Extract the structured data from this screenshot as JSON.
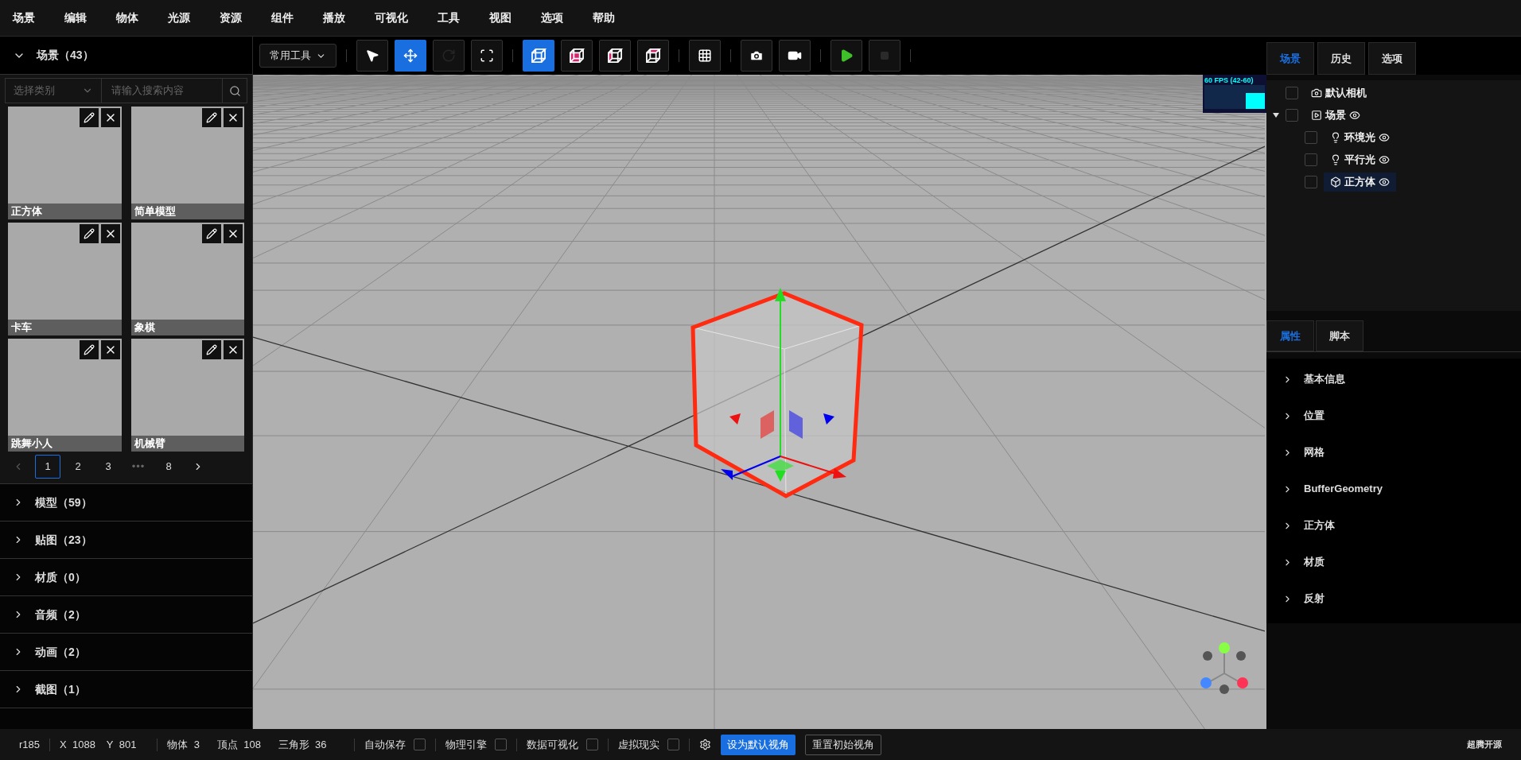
{
  "menu": [
    "场景",
    "编辑",
    "物体",
    "光源",
    "资源",
    "组件",
    "播放",
    "可视化",
    "工具",
    "视图",
    "选项",
    "帮助"
  ],
  "assets": {
    "title": "场景（43）",
    "expanded": true,
    "category_placeholder": "选择类别",
    "search_placeholder": "请输入搜索内容",
    "items": [
      {
        "label": "正方体"
      },
      {
        "label": "简单模型"
      },
      {
        "label": "卡车"
      },
      {
        "label": "象棋"
      },
      {
        "label": "跳舞小人"
      },
      {
        "label": "机械臂"
      }
    ],
    "pages": [
      {
        "label": "1",
        "kind": "page",
        "selected": true
      },
      {
        "label": "2",
        "kind": "page",
        "selected": false
      },
      {
        "label": "3",
        "kind": "page",
        "selected": false
      },
      {
        "label": "•••",
        "kind": "ellipsis",
        "selected": false
      },
      {
        "label": "8",
        "kind": "page",
        "selected": false
      }
    ],
    "sections": [
      {
        "title": "模型（59）",
        "expanded": false
      },
      {
        "title": "贴图（23）",
        "expanded": false
      },
      {
        "title": "材质（0）",
        "expanded": false
      },
      {
        "title": "音频（2）",
        "expanded": false
      },
      {
        "title": "动画（2）",
        "expanded": false
      },
      {
        "title": "截图（1）",
        "expanded": false
      }
    ]
  },
  "toolbar": {
    "dropdown": "常用工具",
    "groups": [
      [
        {
          "kind": "select",
          "selected": false,
          "disabled": false
        },
        {
          "kind": "move",
          "selected": true,
          "disabled": false
        },
        {
          "kind": "rotate",
          "selected": false,
          "disabled": true
        },
        {
          "kind": "scale",
          "selected": false,
          "disabled": false
        }
      ],
      [
        {
          "kind": "view-wire",
          "selected": true,
          "disabled": false
        },
        {
          "kind": "view-front",
          "selected": false,
          "disabled": false
        },
        {
          "kind": "view-side",
          "selected": false,
          "disabled": false
        },
        {
          "kind": "view-top",
          "selected": false,
          "disabled": false
        }
      ],
      [
        {
          "kind": "grid",
          "selected": false,
          "disabled": false
        }
      ],
      [
        {
          "kind": "camera",
          "selected": false,
          "disabled": false
        },
        {
          "kind": "video",
          "selected": false,
          "disabled": false
        }
      ],
      [
        {
          "kind": "play",
          "selected": false,
          "disabled": false
        },
        {
          "kind": "stop",
          "selected": false,
          "disabled": true
        }
      ]
    ]
  },
  "viewport": {
    "fps": "60 FPS (42-60)"
  },
  "outliner": {
    "tabs": [
      {
        "label": "场景",
        "selected": true
      },
      {
        "label": "历史",
        "selected": false
      },
      {
        "label": "选项",
        "selected": false
      }
    ],
    "tree": [
      {
        "label": "默认相机",
        "kind": "camera",
        "eye": false,
        "checked": false,
        "selected": false
      },
      {
        "label": "场景",
        "kind": "scene",
        "eye": true,
        "checked": false,
        "selected": false,
        "expanded": true,
        "children": [
          {
            "label": "环境光",
            "kind": "light",
            "eye": true,
            "checked": false,
            "selected": false
          },
          {
            "label": "平行光",
            "kind": "light",
            "eye": true,
            "checked": false,
            "selected": false
          },
          {
            "label": "正方体",
            "kind": "mesh",
            "eye": true,
            "checked": false,
            "selected": true
          }
        ]
      }
    ]
  },
  "properties": {
    "tabs": [
      {
        "label": "属性",
        "selected": true
      },
      {
        "label": "脚本",
        "selected": false
      }
    ],
    "sections": [
      {
        "title": "基本信息",
        "expanded": false
      },
      {
        "title": "位置",
        "expanded": false
      },
      {
        "title": "网格",
        "expanded": false
      },
      {
        "title": "BufferGeometry",
        "expanded": false
      },
      {
        "title": "正方体",
        "expanded": false
      },
      {
        "title": "材质",
        "expanded": false
      },
      {
        "title": "反射",
        "expanded": false
      }
    ]
  },
  "status_bar": {
    "version": "r185",
    "coords": [
      {
        "label": "X",
        "value": "1088"
      },
      {
        "label": "Y",
        "value": "801"
      }
    ],
    "stats": [
      {
        "label": "物体",
        "value": "3"
      },
      {
        "label": "顶点",
        "value": "108"
      },
      {
        "label": "三角形",
        "value": "36"
      }
    ],
    "toggles": [
      {
        "label": "自动保存",
        "checked": false
      },
      {
        "label": "物理引擎",
        "checked": false
      },
      {
        "label": "数据可视化",
        "checked": false
      },
      {
        "label": "虚拟现实",
        "checked": false
      }
    ],
    "buttons": [
      {
        "label": "设为默认视角",
        "kind": "primary"
      },
      {
        "label": "重置初始视角",
        "kind": "outline"
      }
    ],
    "brand": "超腾开源"
  }
}
